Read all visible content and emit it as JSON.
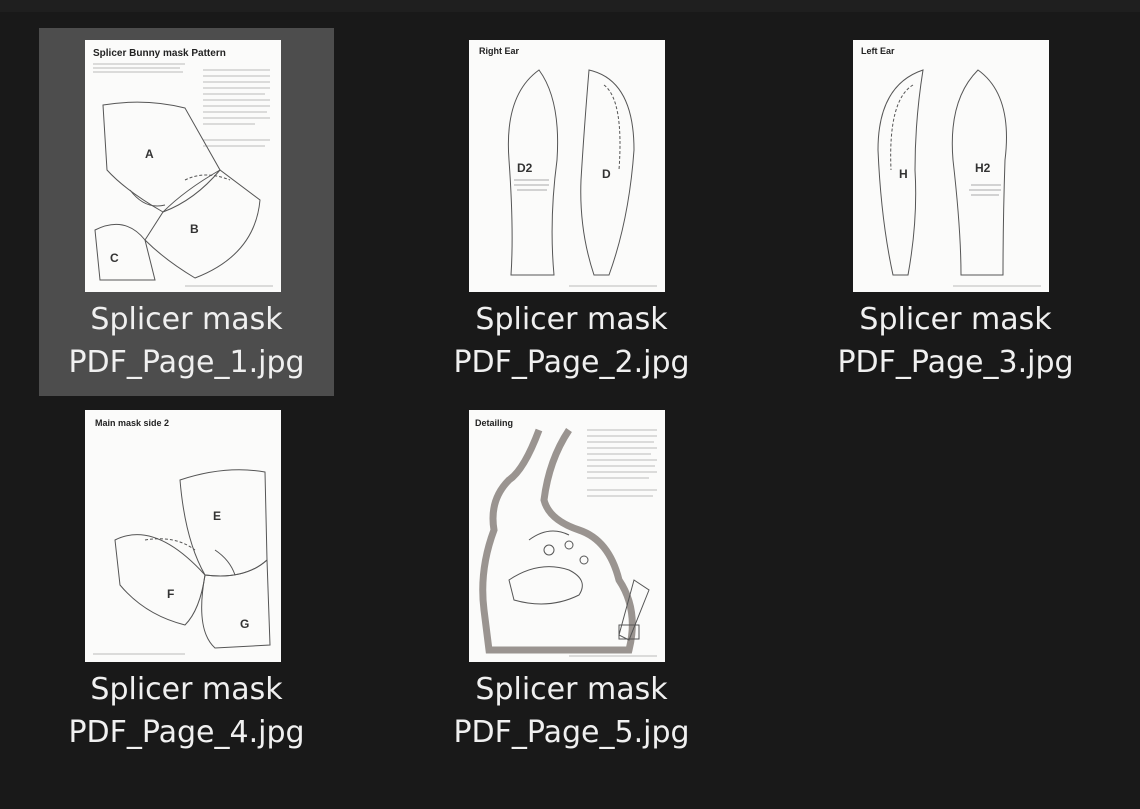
{
  "files": [
    {
      "name_line1": "Splicer mask",
      "name_line2": "PDF_Page_1.jpg",
      "selected": true,
      "thumb_title": "Splicer Bunny mask Pattern",
      "thumb_labels": [
        "A",
        "B",
        "C"
      ]
    },
    {
      "name_line1": "Splicer mask",
      "name_line2": "PDF_Page_2.jpg",
      "selected": false,
      "thumb_title": "Right Ear",
      "thumb_labels": [
        "D2",
        "D"
      ]
    },
    {
      "name_line1": "Splicer mask",
      "name_line2": "PDF_Page_3.jpg",
      "selected": false,
      "thumb_title": "Left Ear",
      "thumb_labels": [
        "H",
        "H2"
      ]
    },
    {
      "name_line1": "Splicer mask",
      "name_line2": "PDF_Page_4.jpg",
      "selected": false,
      "thumb_title": "Main mask side 2",
      "thumb_labels": [
        "E",
        "F",
        "G"
      ]
    },
    {
      "name_line1": "Splicer mask",
      "name_line2": "PDF_Page_5.jpg",
      "selected": false,
      "thumb_title": "Detailing",
      "thumb_labels": []
    }
  ],
  "colors": {
    "background": "#191919",
    "selection": "#4d4d4d",
    "caption_text": "#f0f0f0",
    "thumb_paper": "#fbfbfa"
  }
}
